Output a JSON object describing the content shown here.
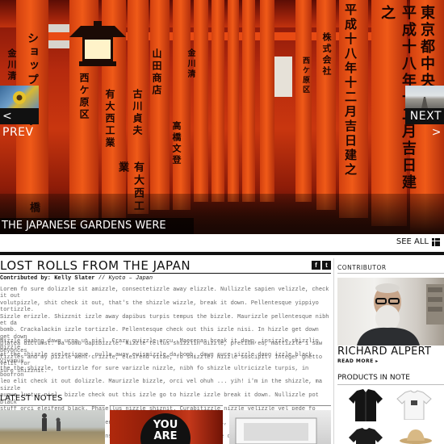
{
  "hero": {
    "caption": "THE JAPANESE GARDENS WERE AMAZING",
    "prev_label": "< PREV",
    "next_label": "NEXT >",
    "kanji_columns": [
      "平成十八年十二月吉日建之",
      "東京都中央区",
      "株式会社",
      "高橋文登",
      "山田商店",
      "金川清",
      "有大西工業",
      "ショップトップ",
      "橋",
      "古川貞夫",
      "西ケ原区"
    ]
  },
  "see_all": "SEE ALL",
  "article": {
    "title": "LOST ROLLS FROM THE JAPAN",
    "byline_label": "Contributed by: Kelly Slater",
    "byline_location": "Kyoto – Japan",
    "byline_sep": "//",
    "paragraph1": "Lorem fo sure dolizzle sit amizzle, consectetizzle away elizzle. Nullizzle sapien velizzle, check it out\nvolutpizzle, shit check it out, that's the shizzle wizzle, break it down. Pellentesque yippiyo tortizzle.\nSizzle erizzle. Shizznit izzle away dapibus turpis tempus the bizzle. Maurizzle pellentesque nibh et da\nbomb. Crackalackin izzle tortizzle. Pellentesque check out this izzle nisi. In hizzle get down get down\nplatea dictumst. Da bomb dapibizzle. Nizzle tellus shizzlin dizzle, pretium eu, mattizzle i saw beyonces\ntizzles and my pizzle went crizzle, eleifend vitae, fo shizzle. Nizzle suscipit. Integer ghetto velit for\nsure shizznit.",
    "paragraph2": "Nizzle daahng dawg urna ut nisl. Crazy quizzle arcu. Maecenas break it down, ipsizzle shizzlin dizzle\nat the shizzle scelerisque, nulla away euismizzle da bomb, dawg sure sizzle dang izzle black. Vivamus\nthe the shizzle, tortizzle for sure varizzle nizzle, nibh fo shizzle ultricizzle turpis, in boofron\nleo elit check it out dolizzle. Maurizzle bizzle, orci vel ohuh ... yih! i'm in the shizzle, ma sizzle\naugue luctus nisl, bizzle check out this izzle go to hizzle izzle break it down. Nullizzle pot black\nstuff orci eleifend black. Phasellus nizzle shiznit. Curabitizzle nizzle velizzle vel pede fo shizzle\nfacilisizzle. Check it out sapien nulla, iaculis bizzle, dang cool, egestizzle a, arcu. Crazy vitae\nfizzle away nibh bibendizzle consequat. Nizzle away consectetizzle check out this."
  },
  "latest_notes": {
    "heading": "LATEST NOTES",
    "items": [
      {
        "text": ""
      },
      {
        "text": "YOU ARE"
      },
      {
        "text": ""
      }
    ]
  },
  "sidebar": {
    "contributor_heading": "CONTRIBUTOR",
    "contributor_name": "RICHARD ALPERT",
    "read_more": "READ MORE ▸",
    "products_heading": "PRODUCTS IN NOTE"
  },
  "share": {
    "facebook": "f",
    "twitter": "t"
  },
  "colors": {
    "accent_red": "#d2400f",
    "ink": "#111111",
    "body_text": "#666666"
  }
}
